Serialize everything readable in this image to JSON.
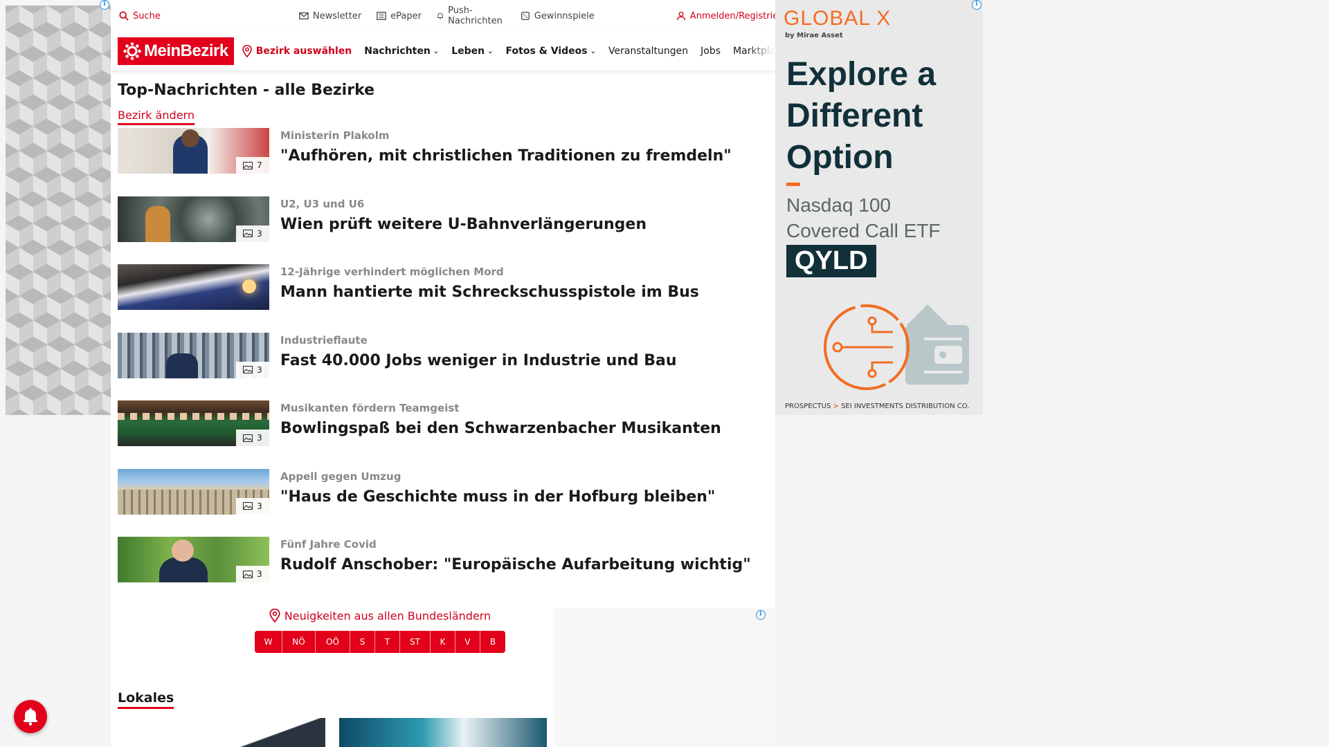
{
  "utility_bar": {
    "search_label": "Suche",
    "newsletter_label": "Newsletter",
    "epaper_label": "ePaper",
    "push_label": "Push-Nachrichten",
    "gewinnspiele_label": "Gewinnspiele",
    "login_label": "Anmelden/Registrieren"
  },
  "navbar": {
    "logo_text": "MeinBezirk",
    "bezirk_label": "Bezirk auswählen",
    "links": [
      {
        "label": "Nachrichten",
        "dropdown": true
      },
      {
        "label": "Leben",
        "dropdown": true
      },
      {
        "label": "Fotos & Videos",
        "dropdown": true
      },
      {
        "label": "Veranstaltungen",
        "dropdown": false
      },
      {
        "label": "Jobs",
        "dropdown": false
      },
      {
        "label": "Marktplatz",
        "dropdown": false
      }
    ]
  },
  "top_news": {
    "title": "Top-Nachrichten - alle Bezirke",
    "change_link": "Bezirk ändern",
    "items": [
      {
        "kicker": "Ministerin Plakolm",
        "headline": "\"Aufhören, mit christlichen Traditionen zu fremdeln\"",
        "photo_count": "7"
      },
      {
        "kicker": "U2, U3 und U6",
        "headline": "Wien prüft weitere U-Bahnverlängerungen",
        "photo_count": "3"
      },
      {
        "kicker": "12-Jährige verhindert möglichen Mord",
        "headline": "Mann hantierte mit Schreckschusspistole im Bus",
        "photo_count": ""
      },
      {
        "kicker": "Industrieflaute",
        "headline": "Fast 40.000 Jobs weniger in Industrie und Bau",
        "photo_count": "3"
      },
      {
        "kicker": "Musikanten fördern Teamgeist",
        "headline": "Bowlingspaß bei den Schwarzenbacher Musikanten",
        "photo_count": "3"
      },
      {
        "kicker": "Appell gegen Umzug",
        "headline": "\"Haus de Geschichte muss in der Hofburg bleiben\"",
        "photo_count": "3"
      },
      {
        "kicker": "Fünf Jahre Covid",
        "headline": "Rudolf Anschober: \"Europäische Aufarbeitung wichtig\"",
        "photo_count": "3"
      }
    ]
  },
  "states": {
    "label": "Neuigkeiten aus allen Bundesländern",
    "items": [
      "W",
      "NÖ",
      "OÖ",
      "S",
      "T",
      "ST",
      "K",
      "V",
      "B"
    ]
  },
  "lokales": {
    "title": "Lokales"
  },
  "ad": {
    "brand": "GLOBAL X",
    "by": "by Mirae Asset",
    "headline_lines": [
      "Explore a",
      "Different",
      "Option"
    ],
    "sub_lines": [
      "Nasdaq 100",
      "Covered Call ETF"
    ],
    "ticker": "QYLD",
    "footer_a": "PROSPECTUS",
    "footer_sep": ">",
    "footer_b": "SEI INVESTMENTS DISTRIBUTION CO.",
    "accent": "#f36c22",
    "dark": "#11303a"
  },
  "colors": {
    "brand_red": "#e2001a",
    "link_red": "#d0021b"
  }
}
